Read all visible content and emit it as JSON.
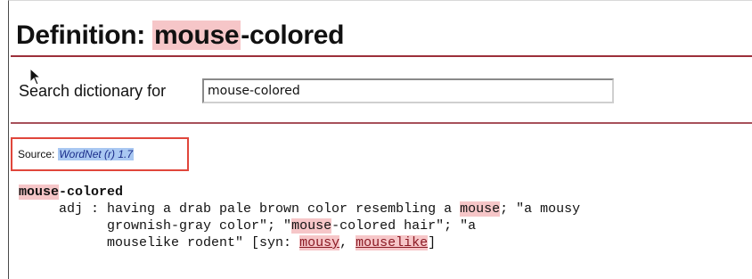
{
  "header": {
    "title_prefix": "Definition: ",
    "title_highlight": "mouse",
    "title_suffix": "-colored"
  },
  "search": {
    "label": "Search dictionary for",
    "value": "mouse-colored"
  },
  "source": {
    "label": "Source:",
    "link_text": "WordNet (r) 1.7"
  },
  "entry": {
    "headword_highlight": "mouse",
    "headword_suffix": "-colored",
    "line1_a": "     adj : having a drab pale brown color resembling a ",
    "line1_hl": "mouse",
    "line1_b": "; \"a mousy",
    "line2_a": "           grownish-gray color\"; \"",
    "line2_hl": "mouse",
    "line2_b": "-colored hair\"; \"a",
    "line3_a": "           mouselike rodent\" [syn: ",
    "syn1": "mousy",
    "syn_sep": ", ",
    "syn2": "mouselike",
    "line3_end": "]"
  },
  "colors": {
    "highlight": "#f6c6c8",
    "rule": "#9c2f3a",
    "source_border": "#e0463b",
    "link_bg": "#a9c8f2",
    "syn_link": "#8a1a24"
  }
}
